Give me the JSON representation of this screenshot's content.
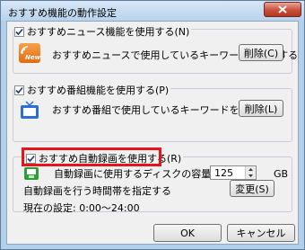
{
  "window": {
    "title": "おすすめ機能の動作設定"
  },
  "news_group": {
    "checkbox_label": "おすすめニュース機能を使用する(N)",
    "checked": true,
    "icon_text": "News",
    "description": "おすすめニュースで使用しているキーワードを削除する",
    "delete_button": "削除(C)"
  },
  "program_group": {
    "checkbox_label": "おすすめ番組機能を使用する(P)",
    "checked": true,
    "description": "おすすめ番組で使用しているキーワードを削除する",
    "delete_button": "削除(L)"
  },
  "recording_group": {
    "checkbox_label": "おすすめ自動録画を使用する(R)",
    "checked": true,
    "capacity_label": "自動録画に使用するディスクの容量(V):",
    "capacity_value": "125",
    "capacity_unit": "GB",
    "time_label": "自動録画を行う時間帯を指定する",
    "change_button": "変更(S)",
    "current_setting": "現在の設定: 0:00〜24:00"
  },
  "footer": {
    "ok": "OK",
    "cancel": "キャンセル"
  },
  "colors": {
    "highlight": "#e8141c",
    "news_icon": "#e9731c",
    "tv_icon": "#2b6fd6",
    "disk_icon": "#2e9e3a"
  }
}
